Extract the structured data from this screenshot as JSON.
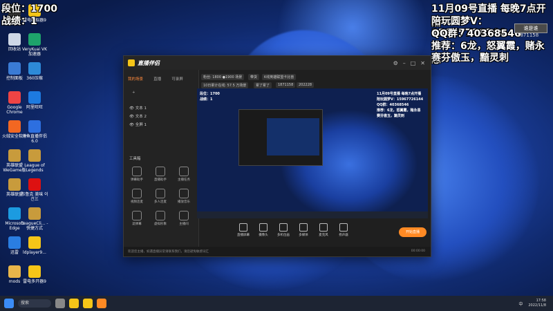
{
  "overlay": {
    "rank_label": "段位：1700",
    "record_label": "战绩：1",
    "stream_schedule": "11月09号直播  每晚7点开播",
    "companion": "陪玩圆梦V：15967726144",
    "qq_group": "QQ群：40368546",
    "recommend": "推荐：6龙，怒翼霞，赌永恩",
    "recommend2": "赛芬傲玉，黯灵刺",
    "badge_text": "谁是谁",
    "badge_num": "1871158"
  },
  "desktop_icons": [
    {
      "label": "Doctor 不仁",
      "color": "#333"
    },
    {
      "label": "雷电模拟器9",
      "color": "#f5c518"
    },
    {
      "label": "回收站",
      "color": "#cfd8e6"
    },
    {
      "label": "VeryKuai VK加速器",
      "color": "#1ea36b"
    },
    {
      "label": "控制面板",
      "color": "#3a7bd5"
    },
    {
      "label": "360压缩",
      "color": "#2d8ad8"
    },
    {
      "label": "Google Chrome",
      "color": "#e44"
    },
    {
      "label": "阿里旺旺",
      "color": "#1d7ae0"
    },
    {
      "label": "火绒安全软件",
      "color": "#f26722"
    },
    {
      "label": "斗鱼直播伴侣6.0",
      "color": "#2d6fe0"
    },
    {
      "label": "英雄联盟 WeGame版",
      "color": "#c89b3c"
    },
    {
      "label": "League of Legends",
      "color": "#c89b3c"
    },
    {
      "label": "英雄联盟",
      "color": "#c89b3c"
    },
    {
      "label": "布鲁克 美味 이건三",
      "color": "#d11"
    },
    {
      "label": "Microsoft Edge",
      "color": "#1c9be0"
    },
    {
      "label": "LeagueCli... - 快捷方式",
      "color": "#c89b3c"
    },
    {
      "label": "迅雷",
      "color": "#2a7de1"
    },
    {
      "label": "ldplayer9...",
      "color": "#f5c518"
    },
    {
      "label": "mods",
      "color": "#e8b54a"
    },
    {
      "label": "雷电多开器9",
      "color": "#f5c518"
    }
  ],
  "app": {
    "title": "直播伴侣",
    "tabs": [
      "我的场景",
      "直播",
      "可录屏"
    ],
    "sources": [
      "文本 1",
      "文本 2",
      "全屏 1"
    ],
    "stats": [
      "粉丝: 1800 ●1900 场景",
      "带货",
      "K线英雄联盟卡比兽",
      "10日累计在线: 57.5 万场景",
      "累了累了",
      "1871158",
      "202228"
    ],
    "tools_title": "工具箱",
    "tools": [
      "弹幕助手",
      "直播助手",
      "主播任务",
      "视频连麦",
      "多人连麦",
      "播放音乐",
      "滤弹幕",
      "虚拟形象",
      "主播间"
    ],
    "bottom_buttons": [
      "直播屏幕",
      "摄像头",
      "多机位画",
      "多媒体",
      "麦克风",
      "扬声器"
    ],
    "start_button": "开始直播",
    "status_left": "欢迎您主播，如遇直播异常请联系我们，请您避免敏感词汇",
    "status_right": "00:00:00"
  },
  "taskbar": {
    "search": "搜索",
    "time": "17:58",
    "date": "2022/11/8",
    "lang": "中"
  }
}
